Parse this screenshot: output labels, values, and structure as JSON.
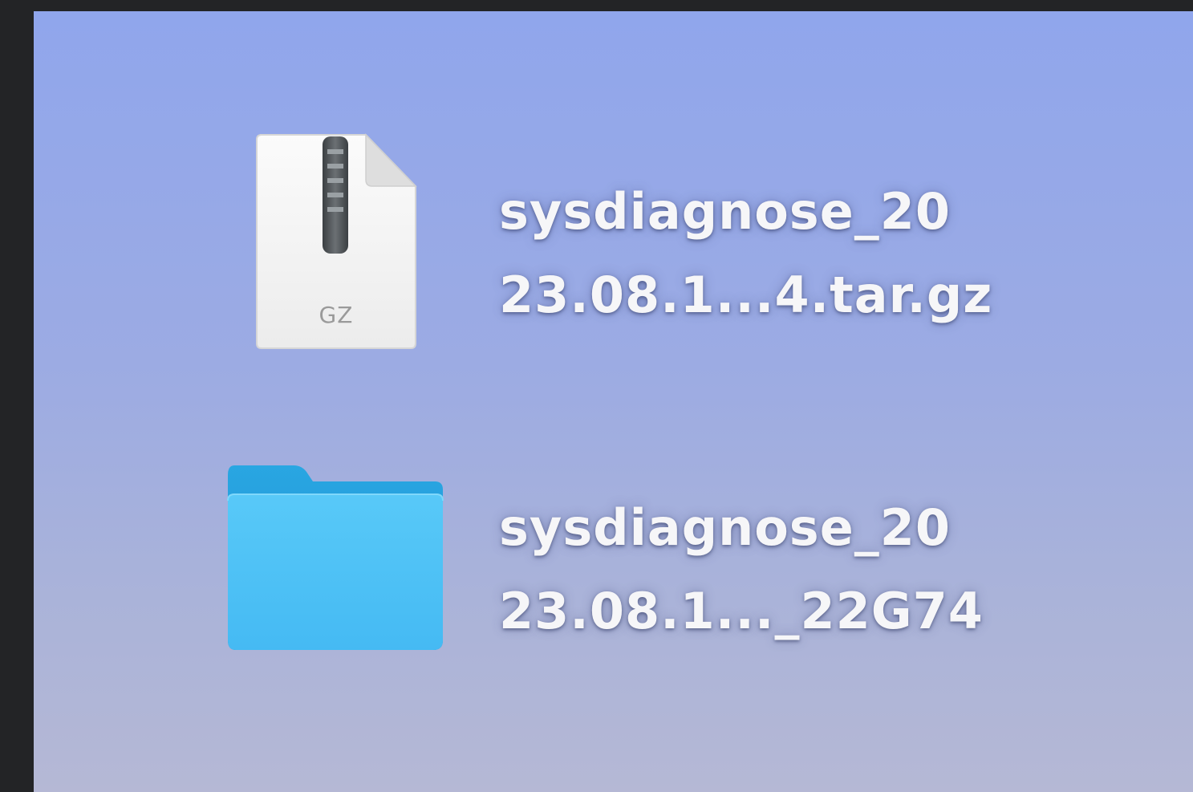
{
  "desktop": {
    "items": [
      {
        "type": "archive",
        "icon": "gz-archive-icon",
        "icon_caption": "GZ",
        "name_lines": [
          "sysdiagnose_20",
          "23.08.1...4.tar.gz"
        ]
      },
      {
        "type": "folder",
        "icon": "folder-icon",
        "name_lines": [
          "sysdiagnose_20",
          "23.08.1..._22G74"
        ]
      }
    ]
  },
  "colors": {
    "frame": "#232426",
    "wallpaper_top": "#90a6ec",
    "wallpaper_bottom": "#b5b8d5",
    "folder_blue": "#4cc3f5",
    "label_text": "#f6f6f8"
  }
}
